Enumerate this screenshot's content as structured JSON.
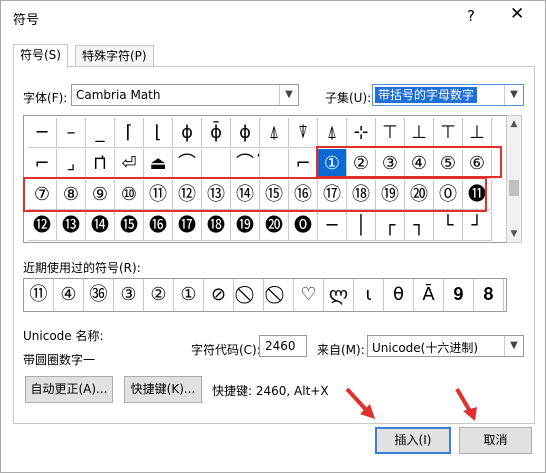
{
  "window": {
    "title": "符号",
    "help": "?",
    "close": "✕"
  },
  "tabs": [
    {
      "label": "符号(S)"
    },
    {
      "label": "特殊字符(P)"
    }
  ],
  "font": {
    "label": "字体(F):",
    "value": "Cambria Math"
  },
  "subset": {
    "label": "子集(U):",
    "value": "带括号的字母数字"
  },
  "grid": {
    "rows": [
      [
        "─",
        "–",
        "_",
        "⌈",
        "⌊",
        "ϕ",
        "ϕ̄",
        "ϕ",
        "⍋",
        "⍒",
        "⍋",
        "⊹",
        "⊤",
        "⊥",
        "⊤",
        "⊥"
      ],
      [
        "⌐",
        "⌟",
        "⊓̇",
        "⏎",
        "⏏",
        "⌒",
        "",
        "⌒̇",
        "",
        "⌐",
        "①",
        "②",
        "③",
        "④",
        "⑤",
        "⑥"
      ],
      [
        "⑦",
        "⑧",
        "⑨",
        "⑩",
        "⑪",
        "⑫",
        "⑬",
        "⑭",
        "⑮",
        "⑯",
        "⑰",
        "⑱",
        "⑲",
        "⑳",
        "⓪",
        "⓫"
      ],
      [
        "⓬",
        "⓭",
        "⓮",
        "⓯",
        "⓰",
        "⓱",
        "⓲",
        "⓳",
        "⓴",
        "⓿",
        "─",
        "│",
        "┌",
        "┐",
        "└",
        "┘"
      ]
    ]
  },
  "recent": {
    "label": "近期使用过的符号(R):",
    "items": [
      "⑪",
      "④",
      "㊱",
      "③",
      "②",
      "①",
      "⊘",
      "⃠",
      "⃠",
      "♡",
      "ლ",
      "ι",
      "θ",
      "Ā",
      "𝟗",
      "𝟖"
    ]
  },
  "unicode": {
    "label": "Unicode 名称:",
    "name": "带圆圈数字一"
  },
  "char_code": {
    "label": "字符代码(C):",
    "value": "2460"
  },
  "from": {
    "label": "来自(M):",
    "value": "Unicode(十六进制)"
  },
  "buttons": {
    "autocorrect": "自动更正(A)...",
    "shortcut_key": "快捷键(K)...",
    "shortcut_text": "快捷键: 2460, Alt+X",
    "insert": "插入(I)",
    "cancel": "取消"
  },
  "colors": {
    "selection": "#0a6ad1",
    "highlight": "#e0302e",
    "button_focus": "#3c7fd6"
  }
}
